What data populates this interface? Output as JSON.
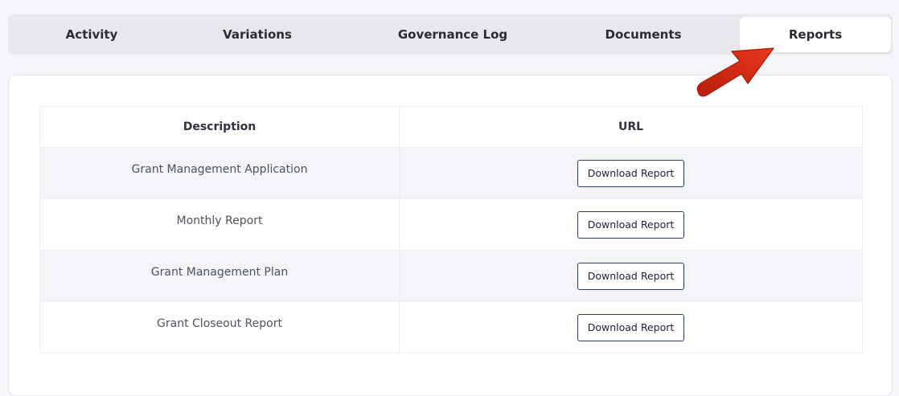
{
  "tabs": [
    {
      "label": "Activity"
    },
    {
      "label": "Variations"
    },
    {
      "label": "Governance Log"
    },
    {
      "label": "Documents"
    },
    {
      "label": "Reports"
    }
  ],
  "active_tab": "Reports",
  "table": {
    "headers": {
      "description": "Description",
      "url": "URL"
    },
    "rows": [
      {
        "description": "Grant Management Application",
        "button": "Download Report"
      },
      {
        "description": "Monthly Report",
        "button": "Download Report"
      },
      {
        "description": "Grant Management Plan",
        "button": "Download Report"
      },
      {
        "description": "Grant Closeout Report",
        "button": "Download Report"
      }
    ]
  },
  "colors": {
    "arrow": "#d62b16",
    "button_border": "#2c3d6b",
    "row_stripe": "#f3f4f8"
  },
  "icons": {
    "annotation": "red-arrow-icon"
  }
}
